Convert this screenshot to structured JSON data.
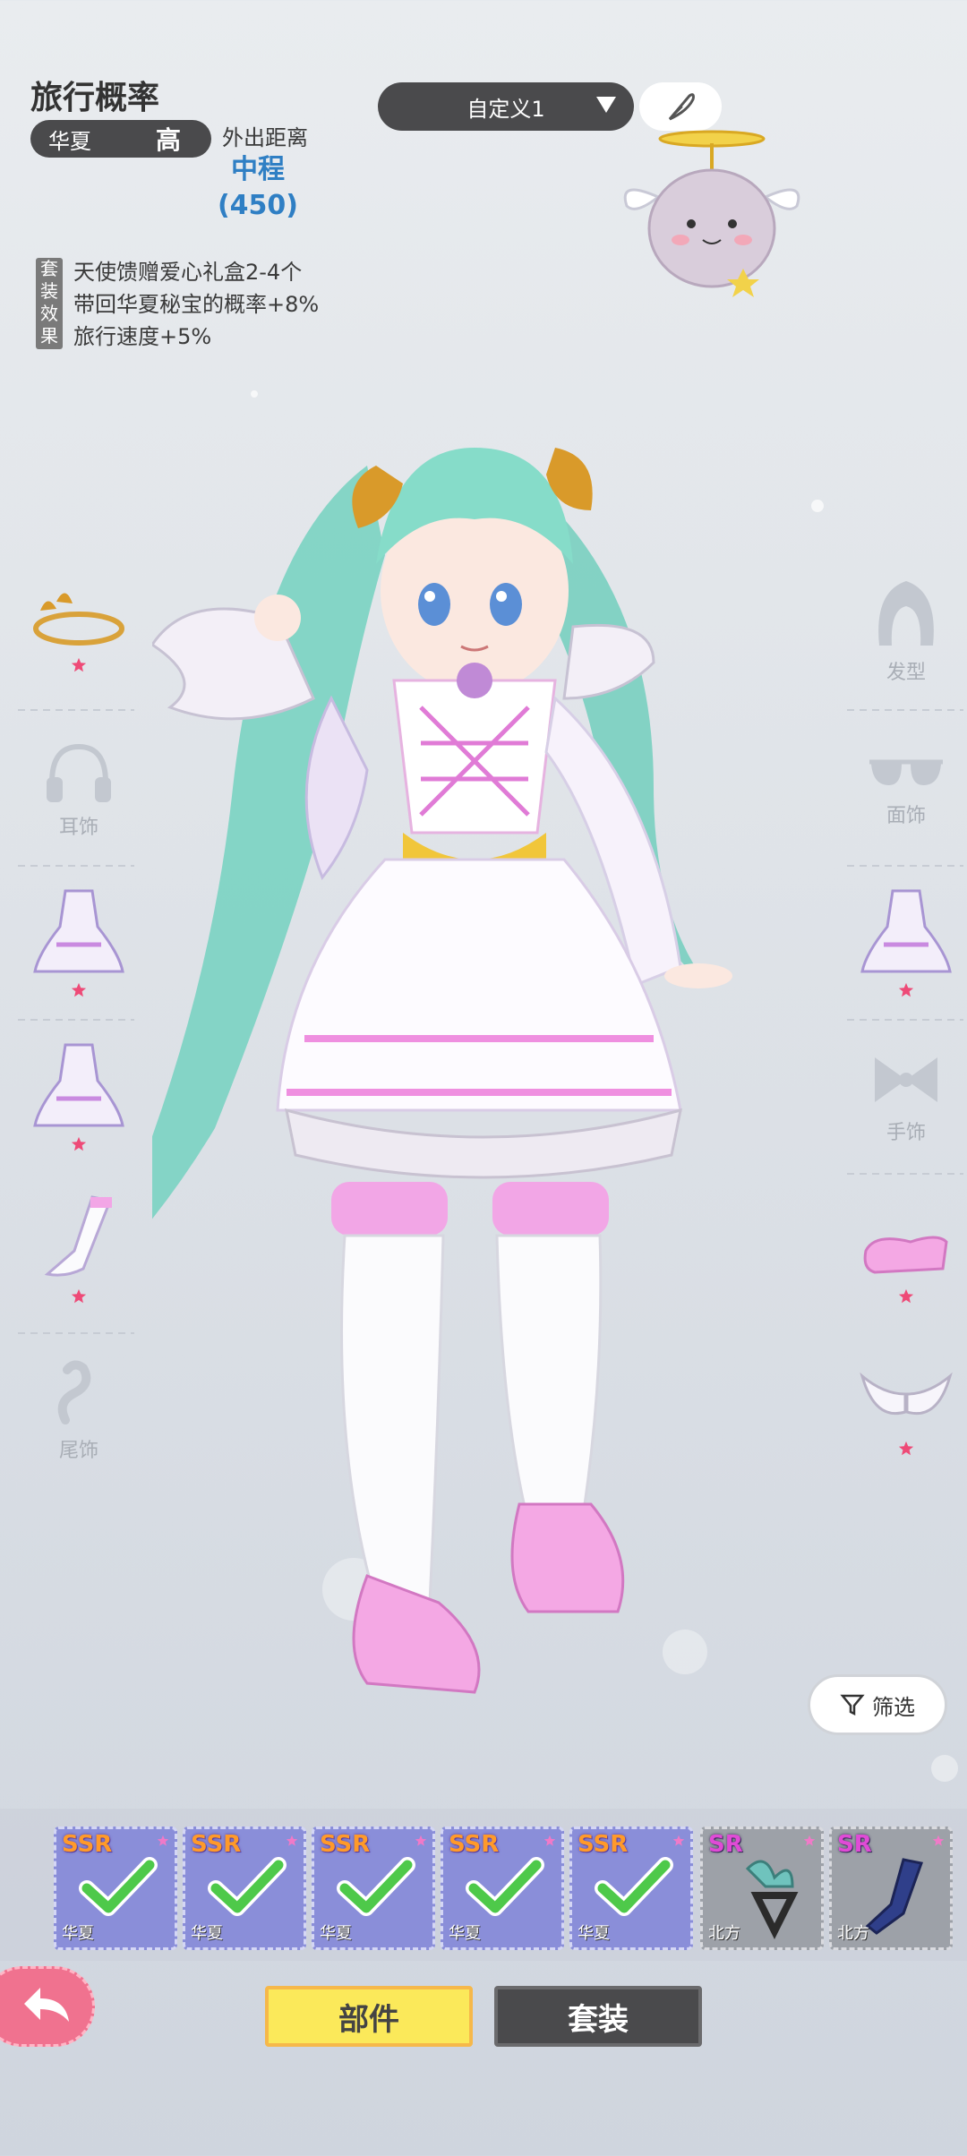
{
  "info": {
    "title": "旅行概率",
    "region": "华夏",
    "level": "高",
    "distance_label": "外出距离",
    "distance_value": "中程",
    "distance_number": "(450)",
    "set_tag": "套装效果",
    "set_effects": [
      "天使馈赠爱心礼盒2-4个",
      "带回华夏秘宝的概率+8%",
      "旅行速度+5%"
    ]
  },
  "preset": {
    "label": "自定义1"
  },
  "left_slots": [
    {
      "label": ""
    },
    {
      "label": "耳饰"
    },
    {
      "label": ""
    },
    {
      "label": ""
    },
    {
      "label": ""
    },
    {
      "label": "尾饰"
    }
  ],
  "right_slots": [
    {
      "label": "发型"
    },
    {
      "label": "面饰"
    },
    {
      "label": ""
    },
    {
      "label": "手饰"
    },
    {
      "label": ""
    },
    {
      "label": ""
    }
  ],
  "filter": {
    "label": "筛选"
  },
  "items": [
    {
      "rarity": "SSR",
      "region": "华夏",
      "equipped": true
    },
    {
      "rarity": "SSR",
      "region": "华夏",
      "equipped": true
    },
    {
      "rarity": "SSR",
      "region": "华夏",
      "equipped": true
    },
    {
      "rarity": "SSR",
      "region": "华夏",
      "equipped": true
    },
    {
      "rarity": "SSR",
      "region": "华夏",
      "equipped": true
    },
    {
      "rarity": "SR",
      "region": "北方",
      "equipped": false
    },
    {
      "rarity": "SR",
      "region": "北方",
      "equipped": false
    }
  ],
  "tabs": {
    "parts": "部件",
    "outfit": "套装"
  },
  "colors": {
    "accent_yellow": "#fbe95a",
    "dark_pill": "#4a4a4c",
    "blue_value": "#2f7fc4",
    "pink_back": "#f0728f",
    "ssr_card": "#8a8ed9"
  }
}
